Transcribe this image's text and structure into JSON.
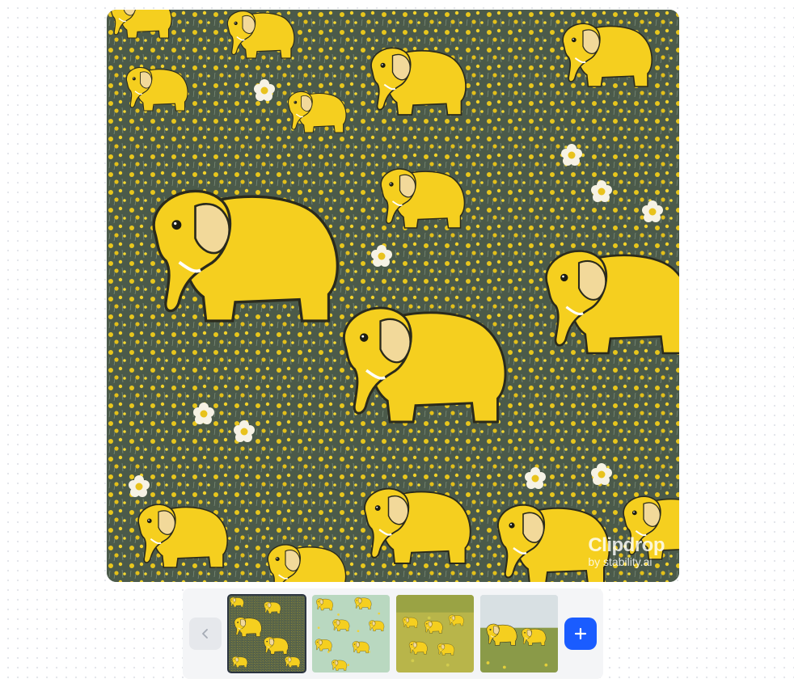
{
  "main_image": {
    "alt": "yellow-elephants-flower-field",
    "watermark": {
      "brand": "Clipdrop",
      "byline": "by stability.ai"
    }
  },
  "thumbnails": [
    {
      "name": "elephants-pattern-dark",
      "selected": true
    },
    {
      "name": "elephants-pattern-mint",
      "selected": false
    },
    {
      "name": "elephants-meadow-herd",
      "selected": false
    },
    {
      "name": "elephants-meadow-3d",
      "selected": false
    }
  ],
  "controls": {
    "prev_icon": "chevron-left-icon",
    "add_icon": "plus-icon"
  },
  "colors": {
    "accent": "#1a5cff",
    "elephant_yellow": "#f5cf1f",
    "field_green": "#4b5a4a"
  }
}
